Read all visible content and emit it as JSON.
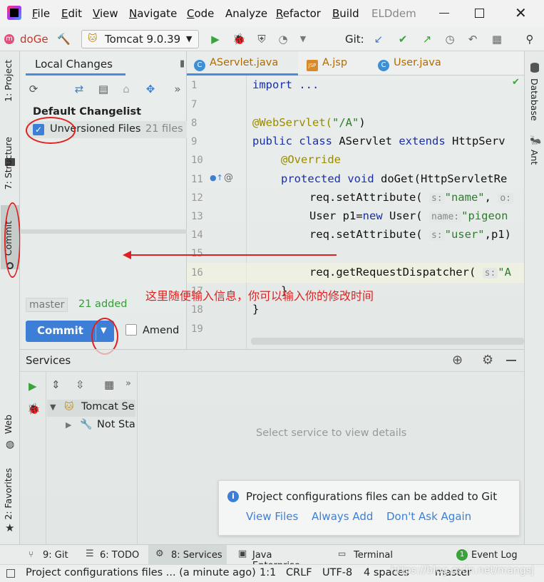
{
  "menu": {
    "items": [
      "File",
      "Edit",
      "View",
      "Navigate",
      "Code",
      "Analyze",
      "Refactor",
      "Build"
    ],
    "mnemonic": [
      "F",
      "E",
      "V",
      "N",
      "C",
      "",
      "R",
      "B"
    ],
    "project_title": "ELDdem"
  },
  "toolbar": {
    "project_name": "doGe",
    "run_config": "Tomcat 9.0.39",
    "git_label": "Git:"
  },
  "left_tabs": {
    "project": "1: Project",
    "structure": "7: Structure",
    "commit": "Commit",
    "web": "Web",
    "favorites": "2: Favorites"
  },
  "right_tabs": {
    "database": "Database",
    "ant": "Ant"
  },
  "commit_panel": {
    "tab_label": "Local Changes",
    "changelist": "Default Changelist",
    "unversioned": "Unversioned Files",
    "file_count": "21 files",
    "branch": "master",
    "added": "21 added",
    "commit_button": "Commit",
    "amend": "Amend"
  },
  "editor": {
    "tabs": [
      "AServlet.java",
      "A.jsp",
      "User.java"
    ],
    "line_numbers": [
      "1",
      "7",
      "8",
      "9",
      "10",
      "11",
      "12",
      "13",
      "14",
      "15",
      "16",
      "17",
      "18",
      "19"
    ],
    "lines": {
      "l1": "import ...",
      "l8a": "@WebServlet(",
      "l8b": "\"/A\"",
      "l8c": ")",
      "l9a": "public class ",
      "l9b": "AServlet ",
      "l9c": "extends ",
      "l9d": "HttpServ",
      "l10": "@Override",
      "l11a": "protected void ",
      "l11b": "doGet(HttpServletRe",
      "l12a": "req.setAttribute(",
      "l12h": "s:",
      "l12b": "\"name\"",
      "l12c": ",",
      "l12h2": "o:",
      "l13a": "User p1=",
      "l13b": "new ",
      "l13c": "User(",
      "l13h": "name:",
      "l13d": "\"pigeon",
      "l14a": "req.setAttribute(",
      "l14h": "s:",
      "l14b": "\"user\"",
      "l14c": ",p1)",
      "l16a": "req.getRequestDispatcher(",
      "l16h": "s:",
      "l16b": "\"A",
      "l17": "}",
      "l18": "}"
    },
    "annotation": "这里随便输入信息，你可以输入你的修改时间"
  },
  "services": {
    "title": "Services",
    "tree": [
      "Tomcat Se",
      "Not Sta"
    ],
    "placeholder": "Select service to view details"
  },
  "notification": {
    "message": "Project configurations files can be added to Git",
    "actions": [
      "View Files",
      "Always Add",
      "Don't Ask Again"
    ]
  },
  "bottom_tabs": {
    "items": [
      "9: Git",
      "6: TODO",
      "8: Services",
      "Java Enterprise",
      "Terminal",
      "Event Log"
    ],
    "event_count": "1"
  },
  "status": {
    "message": "Project configurations files ... (a minute ago)",
    "position": "1:1",
    "line_sep": "CRLF",
    "encoding": "UTF-8",
    "indent": "4 spaces",
    "branch": "master",
    "watermark": "https://blog.csdn.net/mangsj"
  },
  "colors": {
    "accent": "#3d7fd6",
    "annotation_red": "#e02020",
    "run_green": "#3aa33a",
    "string_green": "#2f7b2f",
    "keyword_blue": "#1a2ea8"
  }
}
